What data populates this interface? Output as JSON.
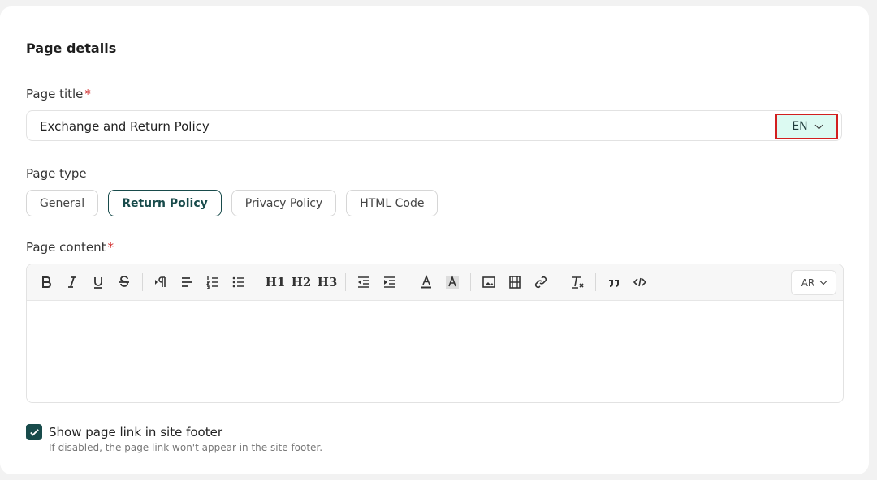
{
  "section": {
    "title": "Page details"
  },
  "page_title": {
    "label": "Page title",
    "required_mark": "*",
    "value": "Exchange and Return Policy",
    "language": "EN"
  },
  "page_type": {
    "label": "Page type",
    "options": [
      "General",
      "Return Policy",
      "Privacy Policy",
      "HTML Code"
    ],
    "selected": "Return Policy"
  },
  "page_content": {
    "label": "Page content",
    "required_mark": "*",
    "language": "AR",
    "toolbar_icons": [
      "bold-icon",
      "italic-icon",
      "underline-icon",
      "strikethrough-icon",
      "text-direction-icon",
      "align-icon",
      "ordered-list-icon",
      "bullet-list-icon",
      "heading1-icon",
      "heading2-icon",
      "heading3-icon",
      "outdent-icon",
      "indent-icon",
      "font-color-icon",
      "highlight-icon",
      "image-icon",
      "video-icon",
      "link-icon",
      "clear-format-icon",
      "quote-icon",
      "code-icon"
    ],
    "heading_labels": [
      "H1",
      "H2",
      "H3"
    ]
  },
  "footer_link": {
    "checked": true,
    "label": "Show page link in site footer",
    "hint": "If disabled, the page link won't appear in the site footer."
  },
  "colors": {
    "accent": "#184b4b",
    "lang_bg": "#dcfaf2",
    "highlight_border": "#d21f1f",
    "required": "#d02828"
  }
}
